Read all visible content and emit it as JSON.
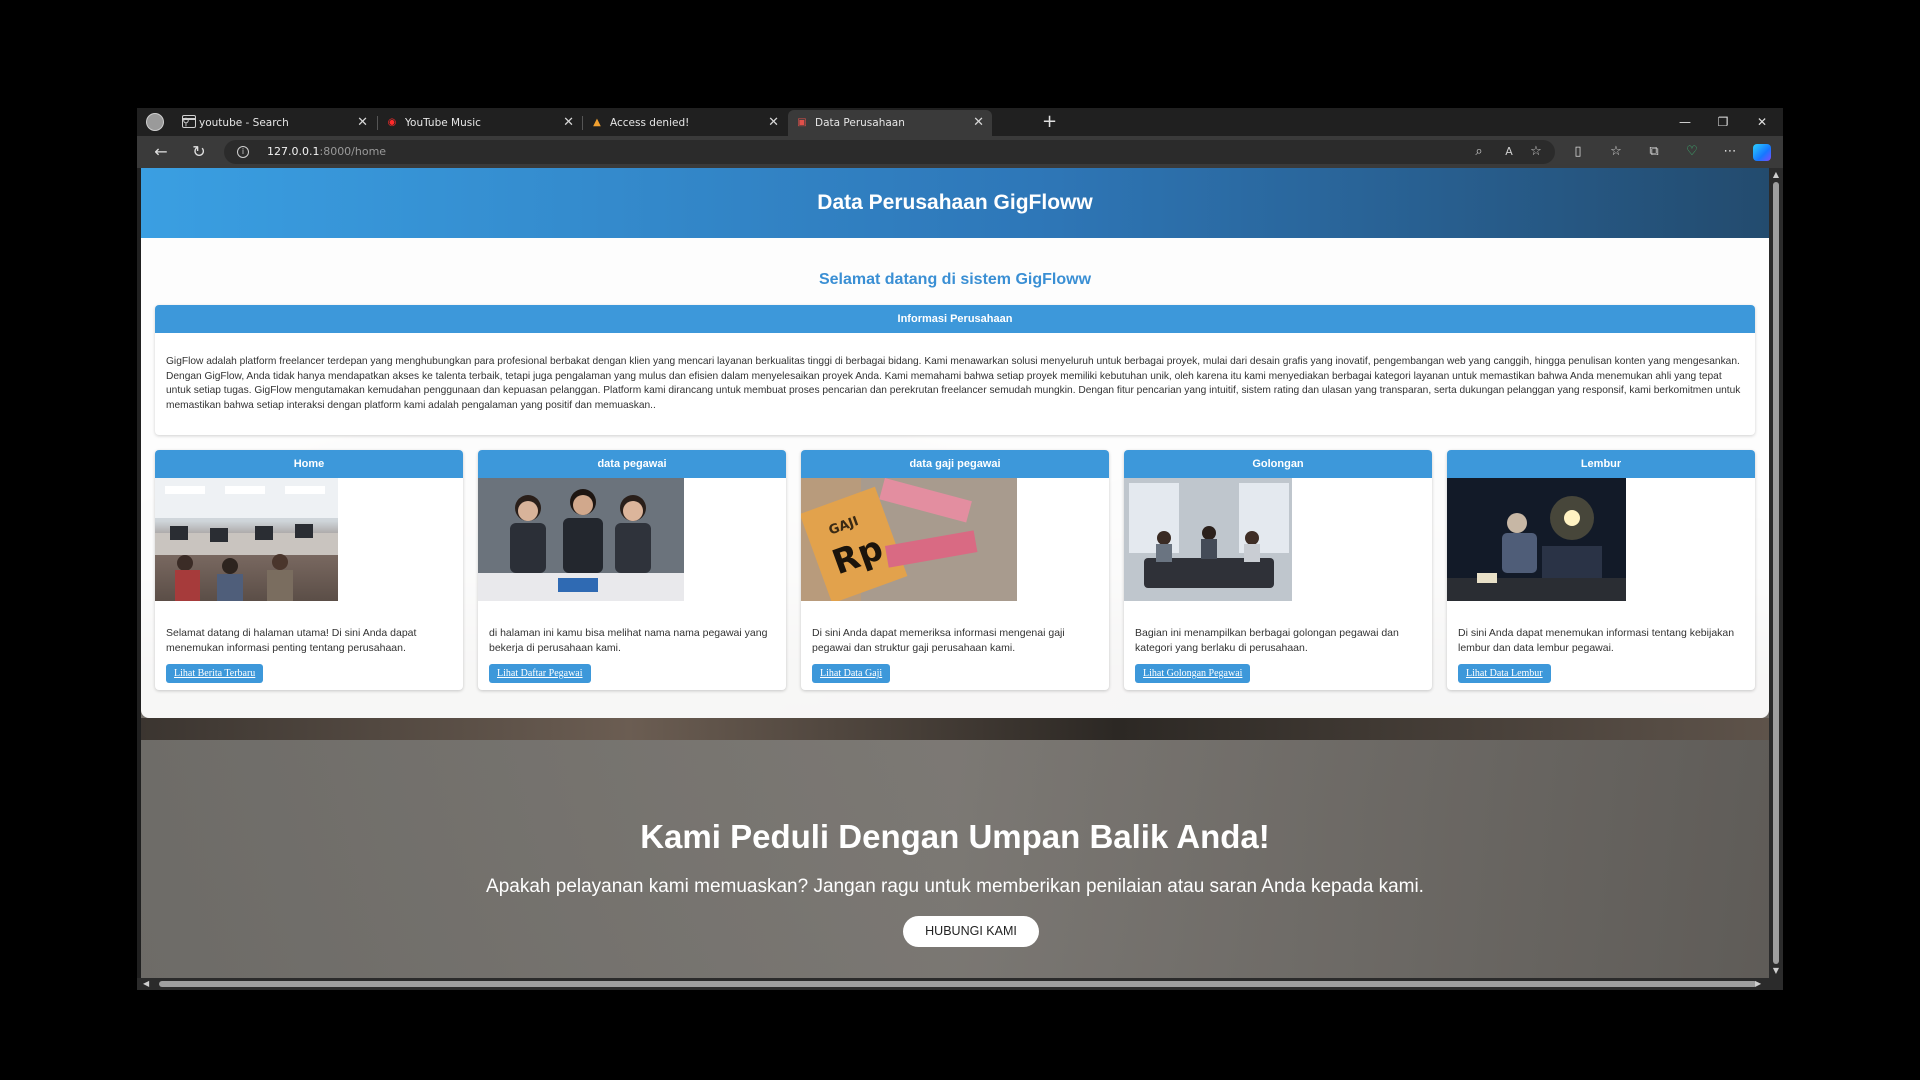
{
  "browser": {
    "tabs": [
      {
        "label": "youtube - Search",
        "icon": "search-icon"
      },
      {
        "label": "YouTube Music",
        "icon": "youtube-music-icon"
      },
      {
        "label": "Access denied!",
        "icon": "warning-icon"
      },
      {
        "label": "Data Perusahaan",
        "icon": "page-icon"
      }
    ],
    "url_host": "127.0.0.1",
    "url_rest": ":8000/home"
  },
  "page": {
    "header_title": "Data Perusahaan GigFloww",
    "welcome": "Selamat datang di sistem GigFloww",
    "info": {
      "title": "Informasi Perusahaan",
      "text": "GigFlow adalah platform freelancer terdepan yang menghubungkan para profesional berbakat dengan klien yang mencari layanan berkualitas tinggi di berbagai bidang. Kami menawarkan solusi menyeluruh untuk berbagai proyek, mulai dari desain grafis yang inovatif, pengembangan web yang canggih, hingga penulisan konten yang mengesankan. Dengan GigFlow, Anda tidak hanya mendapatkan akses ke talenta terbaik, tetapi juga pengalaman yang mulus dan efisien dalam menyelesaikan proyek Anda. Kami memahami bahwa setiap proyek memiliki kebutuhan unik, oleh karena itu kami menyediakan berbagai kategori layanan untuk memastikan bahwa Anda menemukan ahli yang tepat untuk setiap tugas. GigFlow mengutamakan kemudahan penggunaan dan kepuasan pelanggan. Platform kami dirancang untuk membuat proses pencarian dan perekrutan freelancer semudah mungkin. Dengan fitur pencarian yang intuitif, sistem rating dan ulasan yang transparan, serta dukungan pelanggan yang responsif, kami berkomitmen untuk memastikan bahwa setiap interaksi dengan platform kami adalah pengalaman yang positif dan memuaskan.."
    },
    "cards": [
      {
        "title": "Home",
        "desc": "Selamat datang di halaman utama! Di sini Anda dapat menemukan informasi penting tentang perusahaan.",
        "button": "Lihat Berita Terbaru"
      },
      {
        "title": "data pegawai",
        "desc": "di halaman ini kamu bisa melihat nama nama pegawai yang bekerja di perusahaan kami.",
        "button": "Lihat Daftar Pegawai"
      },
      {
        "title": "data gaji pegawai",
        "desc": "Di sini Anda dapat memeriksa informasi mengenai gaji pegawai dan struktur gaji perusahaan kami.",
        "button": "Lihat Data Gaji"
      },
      {
        "title": "Golongan",
        "desc": "Bagian ini menampilkan berbagai golongan pegawai dan kategori yang berlaku di perusahaan.",
        "button": "Lihat Golongan Pegawai"
      },
      {
        "title": "Lembur",
        "desc": "Di sini Anda dapat menemukan informasi tentang kebijakan lembur dan data lembur pegawai.",
        "button": "Lihat Data Lembur"
      }
    ],
    "gaji_image_text": {
      "gaji": "GAJI",
      "rp": "Rp"
    },
    "feedback": {
      "heading": "Kami Peduli Dengan Umpan Balik Anda!",
      "text": "Apakah pelayanan kami memuaskan? Jangan ragu untuk memberikan penilaian atau saran Anda kepada kami.",
      "button": "HUBUNGI KAMI"
    }
  },
  "colors": {
    "accent": "#3d98da",
    "welcome": "#3a8fd4"
  }
}
